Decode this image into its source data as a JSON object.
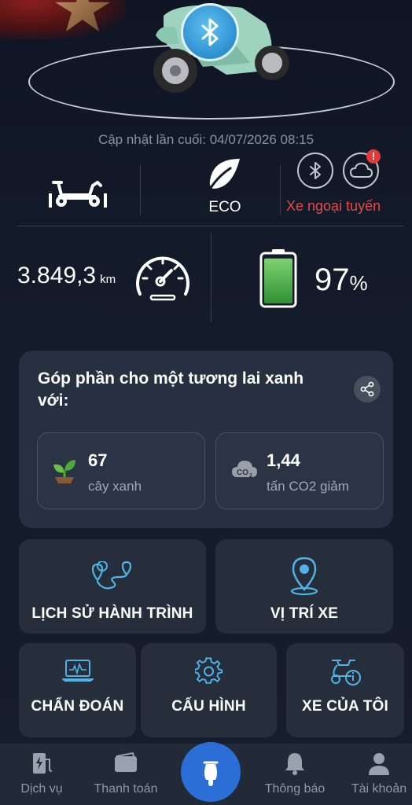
{
  "status": {
    "last_update": "Cập nhật lần cuối: 04/07/2026 08:15",
    "drive_mode": "ECO",
    "connection_status": "Xe ngoại tuyến",
    "cloud_alert_badge": "!"
  },
  "metrics": {
    "odometer_value": "3.849,3",
    "odometer_unit": "km",
    "battery_value": "97",
    "battery_unit": "%",
    "battery_level": 0.97
  },
  "green_card": {
    "title": "Góp phần cho một tương lai xanh với:",
    "trees_value": "67",
    "trees_label": "cây xanh",
    "co2_value": "1,44",
    "co2_label": "tấn CO2 giảm"
  },
  "actions": {
    "trip_history": "LỊCH SỬ HÀNH TRÌNH",
    "vehicle_location": "VỊ TRÍ XE",
    "diagnostics": "CHẨN ĐOÁN",
    "configuration": "CẤU HÌNH",
    "my_vehicle": "XE CỦA TÔI"
  },
  "nav": {
    "services": "Dịch vụ",
    "payment": "Thanh toán",
    "notifications": "Thông báo",
    "account": "Tài khoản"
  },
  "colors": {
    "accent_blue": "#4fb3e6",
    "alert_red": "#e34b45",
    "nav_center": "#2b6fd6",
    "battery_green": "#4cc04a"
  },
  "icons": [
    "bluetooth-icon",
    "scooter-icon",
    "leaf-icon",
    "cloud-icon",
    "speedometer-icon",
    "battery-icon",
    "share-icon",
    "sprout-icon",
    "co2-cloud-icon",
    "route-icon",
    "location-pin-icon",
    "laptop-diagnostic-icon",
    "gear-icon",
    "scooter-info-icon",
    "charging-station-icon",
    "wallet-icon",
    "bell-icon",
    "user-icon"
  ]
}
